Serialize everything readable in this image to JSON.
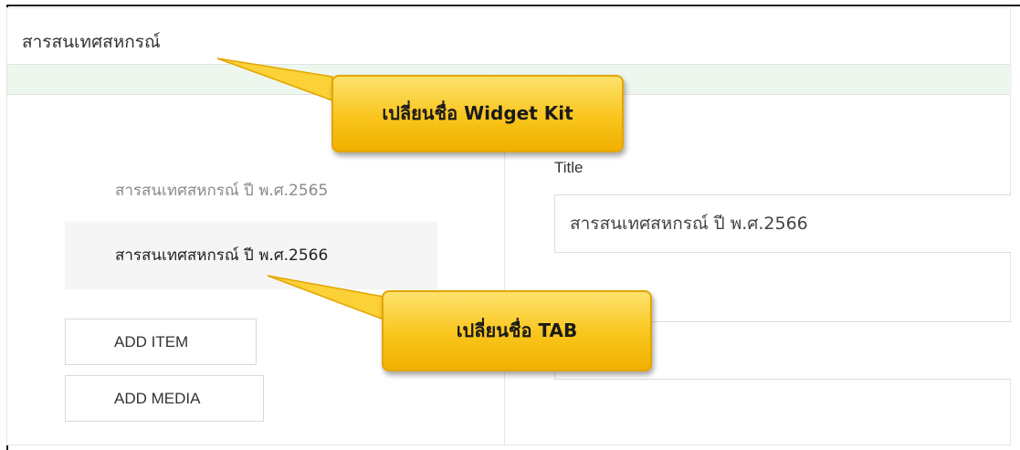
{
  "header": {
    "title": "สารสนเทศสหกรณ์"
  },
  "tabs": [
    {
      "label": "สารสนเทศสหกรณ์ ปี พ.ศ.2565",
      "active": false
    },
    {
      "label": "สารสนเทศสหกรณ์ ปี พ.ศ.2566",
      "active": true
    }
  ],
  "buttons": {
    "add_item": "ADD ITEM",
    "add_media": "ADD MEDIA"
  },
  "form": {
    "title_label": "Title",
    "title_value": "สารสนเทศสหกรณ์ ปี พ.ศ.2566",
    "second_field_value": ""
  },
  "annotations": {
    "widget_kit_callout": "เปลี่ยนชื่อ Widget Kit",
    "tab_callout": "เปลี่ยนชื่อ TAB"
  },
  "colors": {
    "callout_fill": "#f9c51c",
    "callout_border": "#e4a500",
    "active_tab_bg": "#f5f5f5",
    "strip_green": "#eef7ee"
  }
}
